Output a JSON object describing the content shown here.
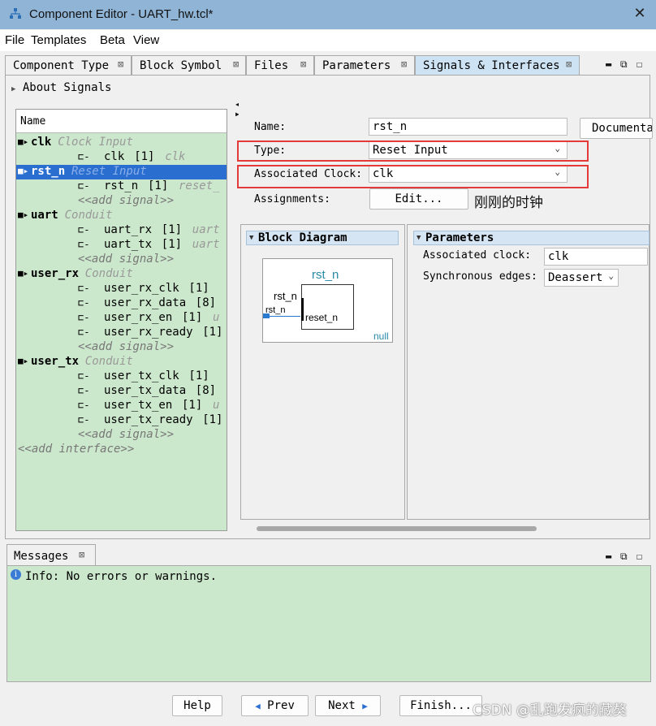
{
  "window": {
    "title": "Component Editor - UART_hw.tcl*",
    "close_glyph": "✕"
  },
  "menu": [
    "File",
    "Templates",
    "Beta",
    "View"
  ],
  "tabs": [
    {
      "label": "Component Type"
    },
    {
      "label": "Block Symbol"
    },
    {
      "label": "Files"
    },
    {
      "label": "Parameters"
    },
    {
      "label": "Signals & Interfaces",
      "active": true
    }
  ],
  "tab_close_glyph": "⊠",
  "about": "About Signals",
  "tree": {
    "header": "Name",
    "rows": [
      {
        "kind": "iface",
        "name": "clk",
        "type": "Clock  Input"
      },
      {
        "kind": "signal",
        "name": "clk",
        "width": "[1]",
        "role": "clk"
      },
      {
        "kind": "iface",
        "name": "rst_n",
        "type": "Reset  Input",
        "selected": true
      },
      {
        "kind": "signal",
        "name": "rst_n",
        "width": "[1]",
        "role": "reset_"
      },
      {
        "kind": "add",
        "text": "<<add  signal>>"
      },
      {
        "kind": "iface",
        "name": "uart",
        "type": "Conduit"
      },
      {
        "kind": "signal",
        "name": "uart_rx",
        "width": "[1]",
        "role": "uart"
      },
      {
        "kind": "signal",
        "name": "uart_tx",
        "width": "[1]",
        "role": "uart"
      },
      {
        "kind": "add",
        "text": "<<add  signal>>"
      },
      {
        "kind": "iface",
        "name": "user_rx",
        "type": "Conduit"
      },
      {
        "kind": "signal",
        "name": "user_rx_clk",
        "width": "[1]",
        "role": ""
      },
      {
        "kind": "signal",
        "name": "user_rx_data",
        "width": "[8]",
        "role": ""
      },
      {
        "kind": "signal",
        "name": "user_rx_en",
        "width": "[1]",
        "role": "u"
      },
      {
        "kind": "signal",
        "name": "user_rx_ready",
        "width": "[1]",
        "role": ""
      },
      {
        "kind": "add",
        "text": "<<add  signal>>"
      },
      {
        "kind": "iface",
        "name": "user_tx",
        "type": "Conduit"
      },
      {
        "kind": "signal",
        "name": "user_tx_clk",
        "width": "[1]",
        "role": ""
      },
      {
        "kind": "signal",
        "name": "user_tx_data",
        "width": "[8]",
        "role": ""
      },
      {
        "kind": "signal",
        "name": "user_tx_en",
        "width": "[1]",
        "role": "u"
      },
      {
        "kind": "signal",
        "name": "user_tx_ready",
        "width": "[1]",
        "role": ""
      },
      {
        "kind": "add",
        "text": "<<add  signal>>"
      },
      {
        "kind": "addroot",
        "text": "<<add  interface>>"
      }
    ]
  },
  "form": {
    "name_label": "Name:",
    "name_value": "rst_n",
    "documentation_label": "Documenta",
    "type_label": "Type:",
    "type_value": "Reset Input",
    "assoc_clock_label": "Associated Clock:",
    "assoc_clock_value": "clk",
    "assignments_label": "Assignments:",
    "edit_button": "Edit...",
    "annotation": "刚刚的时钟"
  },
  "block_diagram": {
    "header": "Block Diagram",
    "component_name": "rst_n",
    "external_pin": "rst_n",
    "external_pin_sub": "rst_n",
    "internal_port": "reset_n",
    "footer": "null"
  },
  "parameters": {
    "header": "Parameters",
    "assoc_clock_label": "Associated clock:",
    "assoc_clock_value": "clk",
    "sync_edges_label": "Synchronous edges:",
    "sync_edges_value": "Deassert"
  },
  "messages": {
    "tab": "Messages",
    "info": "Info: No errors or warnings."
  },
  "footer_buttons": {
    "help": "Help",
    "prev": "Prev",
    "next": "Next",
    "finish": "Finish..."
  },
  "watermark": "CSDN @乱跑发疯的藏獒",
  "colors": {
    "title_bar": "#8fb4d6",
    "tree_bg": "#cce8cc",
    "selection": "#2a6ed0",
    "highlight_box": "#e53a3a"
  }
}
